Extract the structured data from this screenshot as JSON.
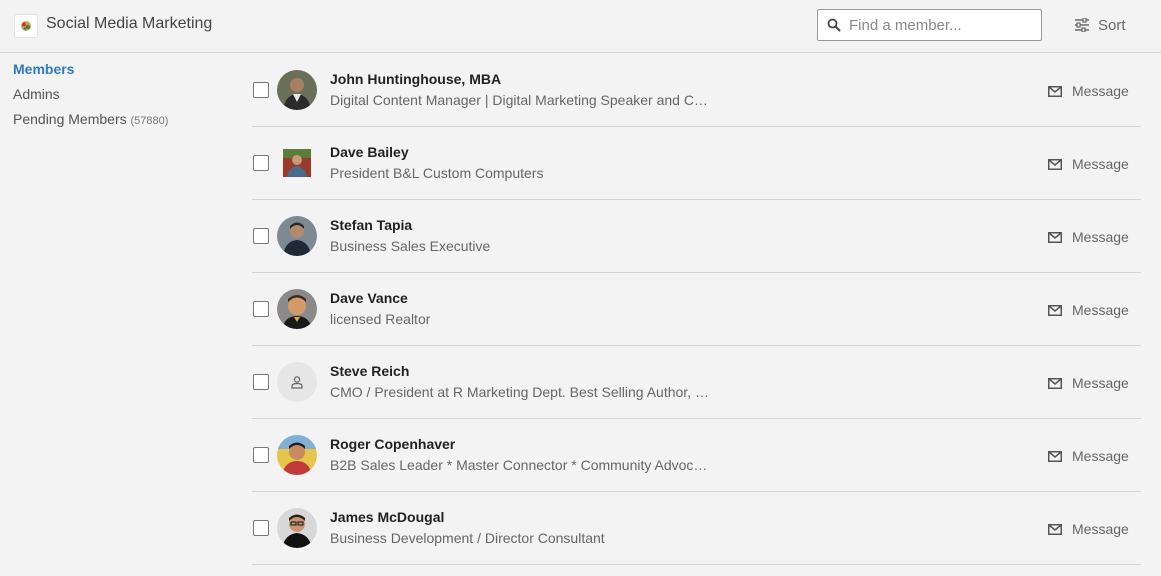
{
  "header": {
    "title": "Social Media Marketing",
    "search": {
      "placeholder": "Find a member...",
      "value": ""
    },
    "sort_label": "Sort"
  },
  "nav": {
    "items": [
      {
        "label": "Members",
        "active": true
      },
      {
        "label": "Admins",
        "active": false
      },
      {
        "label": "Pending Members",
        "count": "(57880)",
        "active": false
      }
    ]
  },
  "members": [
    {
      "name": "John Huntinghouse, MBA",
      "headline": "Digital Content Manager | Digital Marketing Speaker and C…",
      "message_label": "Message",
      "avatar": "photo"
    },
    {
      "name": "Dave Bailey",
      "headline": "President B&L Custom Computers",
      "message_label": "Message",
      "avatar": "square-photo"
    },
    {
      "name": "Stefan Tapia",
      "headline": "Business Sales Executive",
      "message_label": "Message",
      "avatar": "photo"
    },
    {
      "name": "Dave Vance",
      "headline": "licensed Realtor",
      "message_label": "Message",
      "avatar": "photo"
    },
    {
      "name": "Steve Reich",
      "headline": "CMO / President at R Marketing Dept. Best Selling Author, …",
      "message_label": "Message",
      "avatar": "ghost-person-icon"
    },
    {
      "name": "Roger Copenhaver",
      "headline": "B2B Sales Leader * Master Connector * Community Advoc…",
      "message_label": "Message",
      "avatar": "photo"
    },
    {
      "name": "James McDougal",
      "headline": "Business Development / Director Consultant",
      "message_label": "Message",
      "avatar": "photo"
    }
  ],
  "colors": {
    "accent": "#2f7bbf",
    "background": "#f3f3f3",
    "divider": "#d4d4d4"
  }
}
